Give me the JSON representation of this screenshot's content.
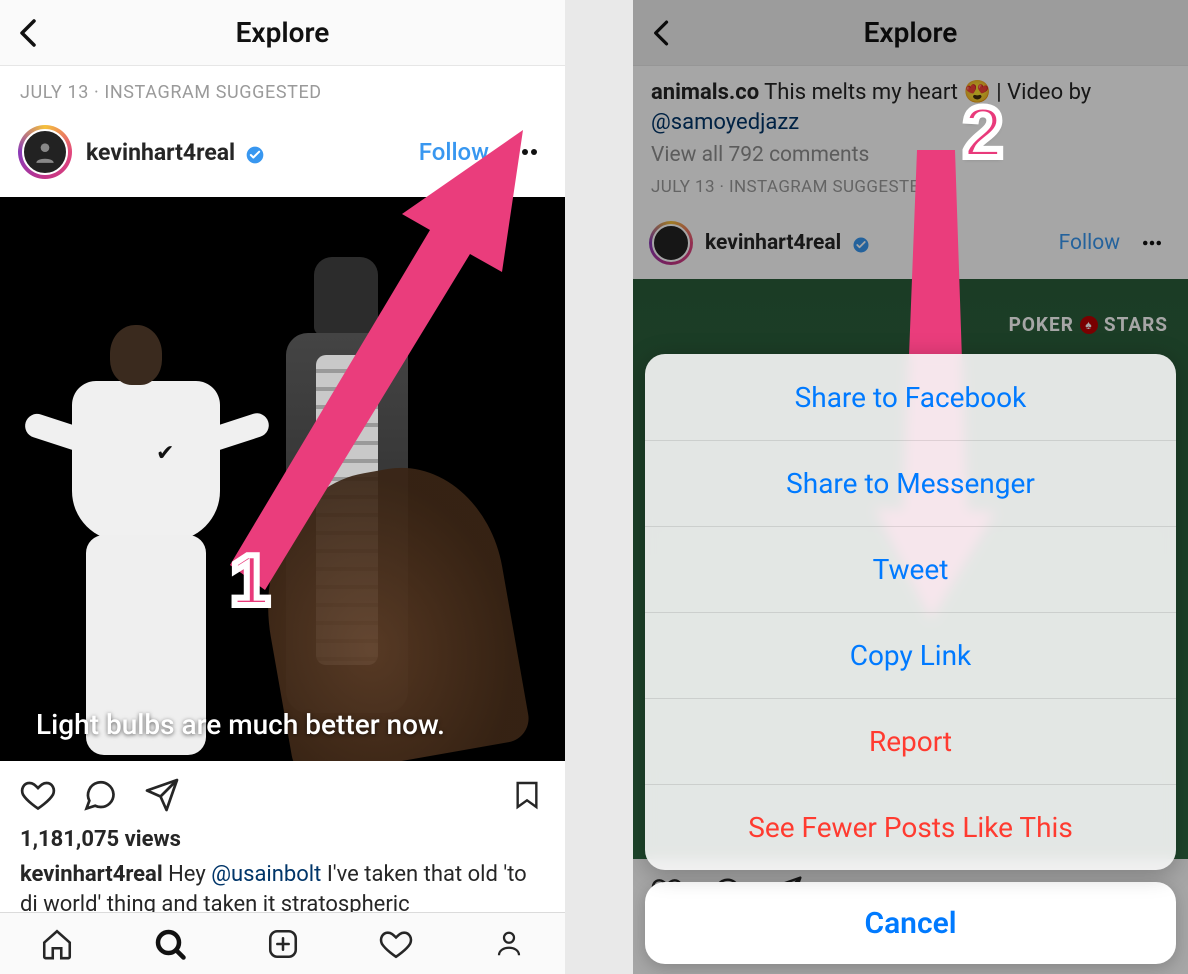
{
  "left": {
    "header_title": "Explore",
    "suggested": "JULY 13 · INSTAGRAM SUGGESTED",
    "username": "kevinhart4real",
    "follow": "Follow",
    "overlay_caption": "Light bulbs are much better now.",
    "views": "1,181,075 views",
    "caption_user": "kevinhart4real",
    "caption_text_pre": " Hey ",
    "caption_mention": "@usainbolt",
    "caption_text_post": " I've taken that old 'to di world' thing and taken it stratospheric",
    "step_badge": "1"
  },
  "right": {
    "header_title": "Explore",
    "post_user": "animals.co",
    "post_text": " This melts my heart 😍 | Video by ",
    "post_mention": "@samoyedjazz",
    "view_comments": "View all 792 comments",
    "suggested": "JULY 13 · INSTAGRAM SUGGESTED",
    "username": "kevinhart4real",
    "follow": "Follow",
    "watermark_left": "POKER",
    "watermark_right": "STARS",
    "step_badge": "2",
    "sheet": {
      "share_fb": "Share to Facebook",
      "share_msg": "Share to Messenger",
      "tweet": "Tweet",
      "copy_link": "Copy Link",
      "report": "Report",
      "fewer": "See Fewer Posts Like This",
      "cancel": "Cancel"
    }
  }
}
